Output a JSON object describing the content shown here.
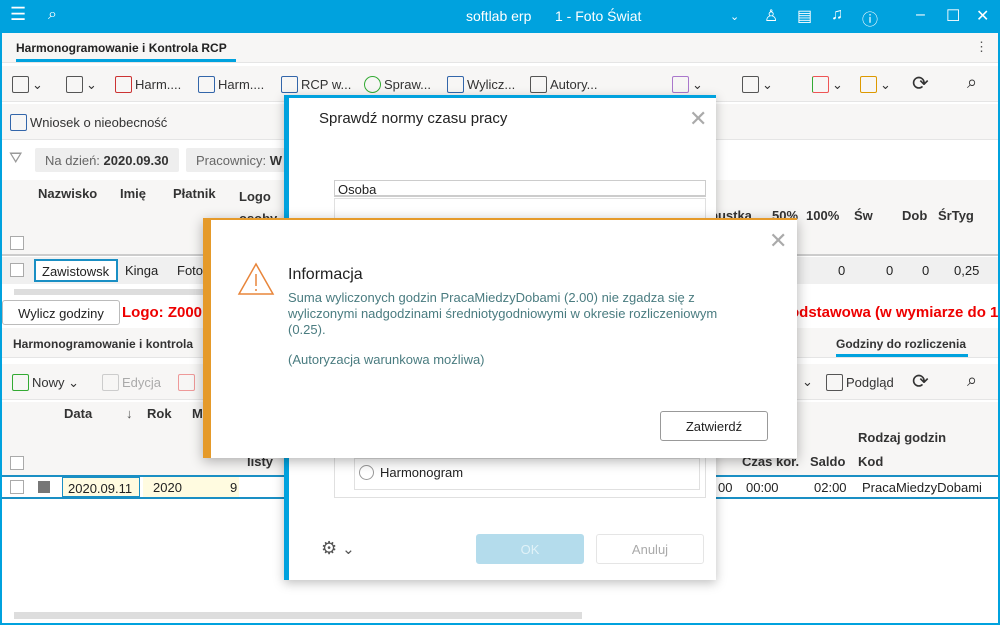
{
  "titlebar": {
    "app": "softlab erp",
    "company": "1 - Foto Świat"
  },
  "tab": {
    "label": "Harmonogramowanie i Kontrola RCP"
  },
  "toolbar": {
    "items": [
      "Harm....",
      "Harm....",
      "RCP w...",
      "Spraw...",
      "Wylicz...",
      "Autory..."
    ]
  },
  "toolbar2": {
    "absence": "Wniosek o nieobecność"
  },
  "filters": {
    "date_label": "Na dzień:",
    "date_value": "2020.09.30",
    "workers_label": "Pracownicy:",
    "workers_value": "W"
  },
  "grid1": {
    "headers": [
      "Nazwisko",
      "Imię",
      "Płatnik",
      "Logo osoby"
    ],
    "right_headers": [
      "pustka",
      "50%",
      "100%",
      "Św",
      "Dob",
      "ŚrTyg"
    ],
    "row": {
      "nazwisko": "Zawistowsk",
      "imie": "Kinga",
      "platnik": "Foto",
      "v50": "0",
      "v100": "0",
      "sw": "0",
      "dob": "0",
      "srtyg": "0,25"
    }
  },
  "action": {
    "compute": "Wylicz godziny",
    "logo_text": "Logo: Z000",
    "info_text": "odstawowa (w wymiarze do 1"
  },
  "section2": {
    "title": "Harmonogramowanie i kontrola",
    "tab_right": "Godziny do rozliczenia",
    "new": "Nowy",
    "edit": "Edycja",
    "preview": "Podgląd"
  },
  "grid2": {
    "headers": [
      "Data",
      "Rok",
      "M",
      "listy"
    ],
    "right_headers": [
      "Czas kor.",
      "Saldo",
      "Rodzaj godzin",
      "Kod"
    ],
    "row": {
      "data": "2020.09.11",
      "rok": "2020",
      "m": "9",
      "partial": "00",
      "czas": "00:00",
      "saldo": "02:00",
      "kod": "PracaMiedzyDobami"
    }
  },
  "dialog1": {
    "title": "Sprawdź normy czasu pracy",
    "field": "Osoba",
    "radio": "Harmonogram",
    "ok": "OK",
    "cancel": "Anuluj"
  },
  "dialog2": {
    "title": "Informacja",
    "message": "Suma wyliczonych godzin PracaMiedzyDobami (2.00) nie zgadza się z wyliczonymi nadgodzinami średniotygodniowymi w okresie rozliczeniowym (0.25).",
    "note": "(Autoryzacja warunkowa możliwa)",
    "confirm": "Zatwierdź"
  },
  "colors": {
    "accent": "#00a2de",
    "warning": "#e59a2a",
    "message": "#4a7c80",
    "error": "#e00000"
  }
}
